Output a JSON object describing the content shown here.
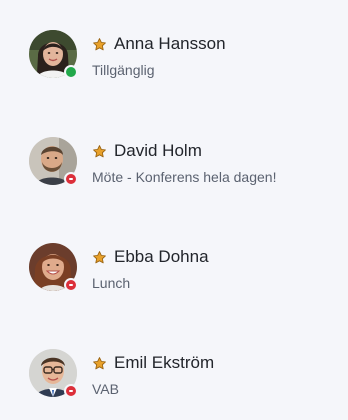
{
  "contacts": [
    {
      "name": "Anna Hansson",
      "status": "Tillgänglig",
      "presence": "available",
      "favorite": true,
      "avatar_icon": "person-avatar"
    },
    {
      "name": "David Holm",
      "status": "Möte - Konferens hela dagen!",
      "presence": "busy",
      "favorite": true,
      "avatar_icon": "person-avatar"
    },
    {
      "name": "Ebba Dohna",
      "status": "Lunch",
      "presence": "busy",
      "favorite": true,
      "avatar_icon": "person-avatar"
    },
    {
      "name": "Emil Ekström",
      "status": "VAB",
      "presence": "busy",
      "favorite": true,
      "avatar_icon": "person-avatar"
    }
  ],
  "colors": {
    "background": "#f5f6fa",
    "available": "#22a84a",
    "busy": "#dc2f3a",
    "favorite_star": "#e8a12b",
    "name_text": "#22252b",
    "status_text": "#5b6270"
  }
}
